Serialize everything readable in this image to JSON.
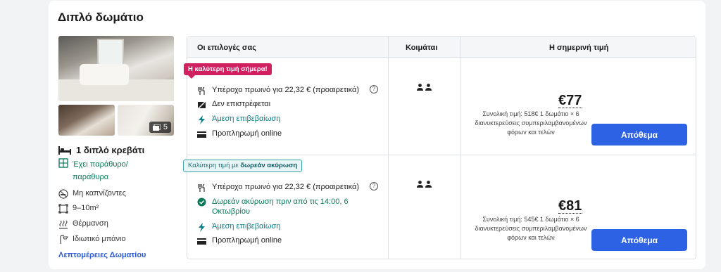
{
  "room": {
    "title": "Διπλό δωμάτιο",
    "photo_count": "5",
    "bed": "1 διπλό κρεβάτι",
    "features": {
      "window": "Έχει παράθυρο/ παράθυρα",
      "non_smoking": "Μη καπνίζοντες",
      "size": "9–10m²",
      "heating": "Θέρμανση",
      "bathroom": "Ιδιωτικό μπάνιο"
    },
    "details_link": "Λεπτομέρειες Δωματίου"
  },
  "table": {
    "headers": {
      "options": "Οι επιλογές σας",
      "sleeps": "Κοιμάται",
      "price": "Η σημερινή τιμή"
    },
    "rows": [
      {
        "badge": "Η καλύτερη τιμή σήμερα!",
        "options": [
          {
            "icon": "breakfast-icon",
            "text": "Υπέροχο πρωινό για 22,32 € (προαιρετικά)"
          },
          {
            "icon": "non-refundable-icon",
            "text": "Δεν επιστρέφεται"
          },
          {
            "icon": "lightning-icon",
            "text": "Άμεση επιβεβαίωση"
          },
          {
            "icon": "card-icon",
            "text": "Προπληρωμή online"
          }
        ],
        "guests": 2,
        "price": "€77",
        "total_note": "Συνολική τιμή: 518€ 1 δωμάτιο × 6 διανυκτερεύσεις συμπεριλαμβανομένων φόρων και τελών",
        "button": "Απόθεμα"
      },
      {
        "badge_prefix": "Καλύτερη τιμή με",
        "badge_bold": "δωρεάν ακύρωση",
        "options": [
          {
            "icon": "breakfast-icon",
            "text": "Υπέροχο πρωινό για 22,32 € (προαιρετικά)"
          },
          {
            "icon": "check-circle-icon",
            "text": "Δωρεάν ακύρωση πριν από τις 14:00, 6 Οκτωβρίου"
          },
          {
            "icon": "lightning-icon",
            "text": "Άμεση επιβεβαίωση"
          },
          {
            "icon": "card-icon",
            "text": "Προπληρωμή online"
          }
        ],
        "guests": 2,
        "price": "€81",
        "total_note": "Συνολική τιμή: 545€ 1 δωμάτιο × 6 διανυκτερεύσεις συμπεριλαμβανομένων φόρων και τελών",
        "button": "Απόθεμα"
      }
    ]
  },
  "colors": {
    "accent": "#2e62e5",
    "best_badge": "#d0205f",
    "free_badge_border": "#3aa0a9",
    "green": "#0b7a5a"
  }
}
